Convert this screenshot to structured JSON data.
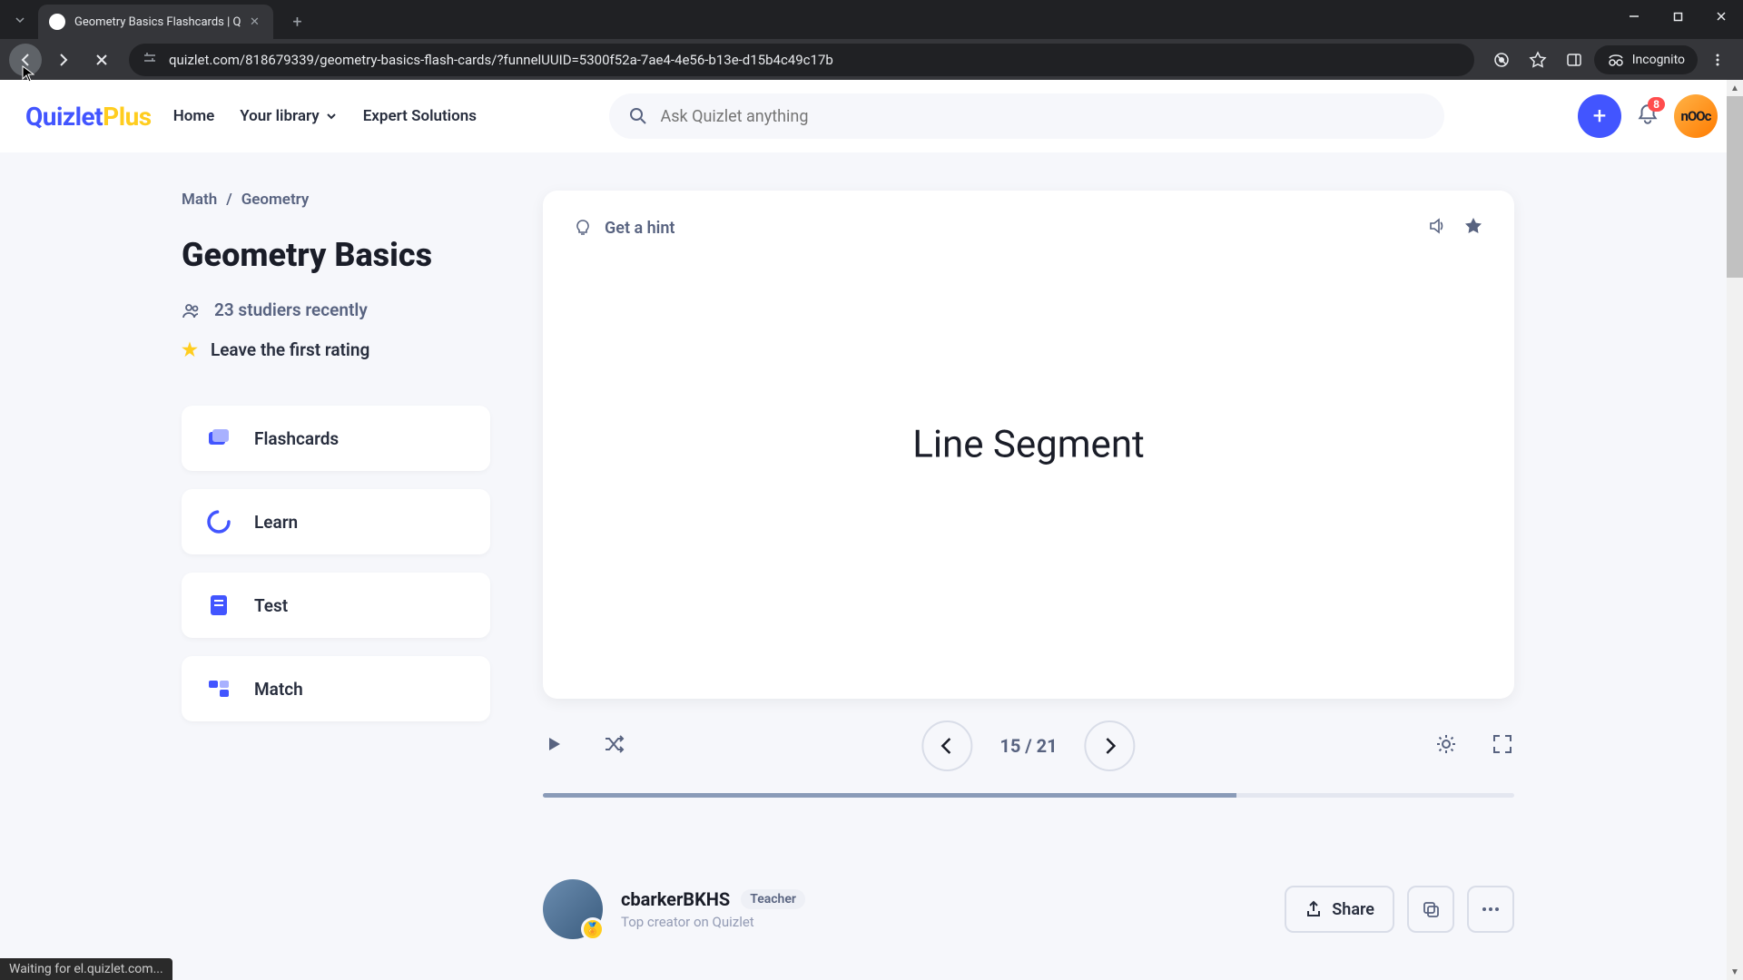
{
  "browser": {
    "tab_title": "Geometry Basics Flashcards | Q",
    "url": "quizlet.com/818679339/geometry-basics-flash-cards/?funnelUUID=5300f52a-7ae4-4e56-b13e-d15b4c49c17b",
    "incognito_label": "Incognito",
    "status_text": "Waiting for el.quizlet.com..."
  },
  "header": {
    "logo_main": "Quizlet",
    "logo_suffix": "Plus",
    "nav": {
      "home": "Home",
      "library": "Your library",
      "expert": "Expert Solutions"
    },
    "search_placeholder": "Ask Quizlet anything",
    "notification_count": "8",
    "avatar_text": "nOOc"
  },
  "breadcrumb": {
    "root": "Math",
    "sep": "/",
    "leaf": "Geometry"
  },
  "page_title": "Geometry Basics",
  "studiers": "23 studiers recently",
  "rating_cta": "Leave the first rating",
  "modes": {
    "flashcards": "Flashcards",
    "learn": "Learn",
    "test": "Test",
    "match": "Match"
  },
  "card": {
    "hint_label": "Get a hint",
    "term": "Line Segment",
    "counter": "15 / 21",
    "progress_percent": 71.4
  },
  "creator": {
    "name": "cbarkerBKHS",
    "tag": "Teacher",
    "subtitle": "Top creator on Quizlet",
    "share_label": "Share"
  }
}
